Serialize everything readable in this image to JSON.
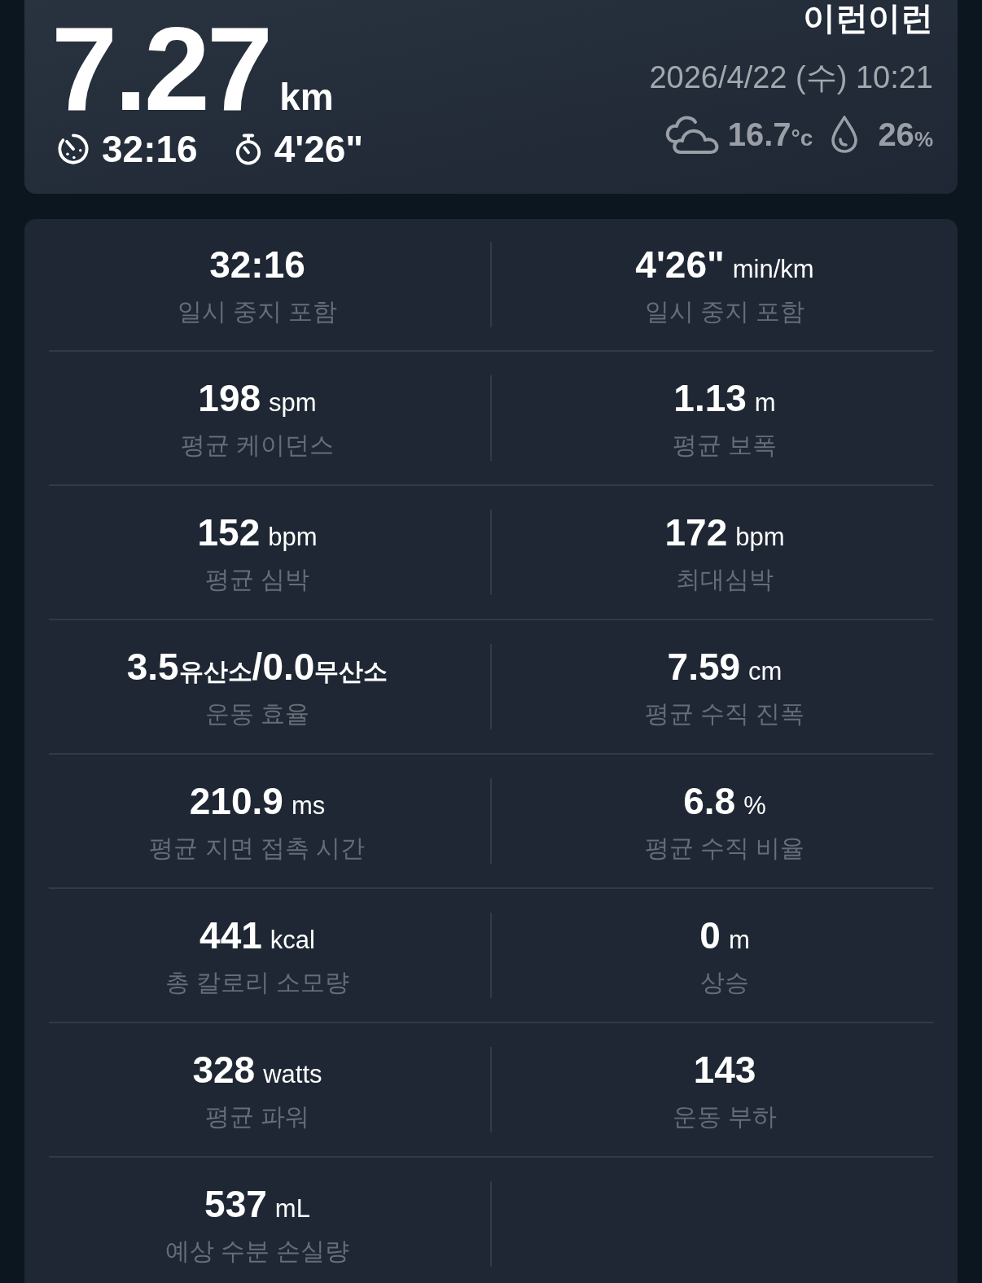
{
  "summary": {
    "distance": {
      "value": "7.27",
      "unit": "km"
    },
    "duration": "32:16",
    "pace": "4'26\"",
    "title": "이런이런",
    "datetime": "2026/4/22 (수) 10:21",
    "weather": {
      "temperature": "16.7",
      "temperature_unit": "°c",
      "humidity": "26",
      "humidity_unit": "%"
    }
  },
  "metrics": [
    {
      "parts": [
        {
          "kind": "number",
          "text": "32:16"
        }
      ],
      "label": "일시 중지 포함"
    },
    {
      "parts": [
        {
          "kind": "number",
          "text": "4'26\""
        },
        {
          "kind": "unit",
          "text": "min/km"
        }
      ],
      "label": "일시 중지 포함"
    },
    {
      "parts": [
        {
          "kind": "number",
          "text": "198"
        },
        {
          "kind": "unit",
          "text": "spm"
        }
      ],
      "label": "평균 케이던스"
    },
    {
      "parts": [
        {
          "kind": "number",
          "text": "1.13"
        },
        {
          "kind": "unit",
          "text": "m"
        }
      ],
      "label": "평균 보폭"
    },
    {
      "parts": [
        {
          "kind": "number",
          "text": "152"
        },
        {
          "kind": "unit",
          "text": "bpm"
        }
      ],
      "label": "평균 심박"
    },
    {
      "parts": [
        {
          "kind": "number",
          "text": "172"
        },
        {
          "kind": "unit",
          "text": "bpm"
        }
      ],
      "label": "최대심박"
    },
    {
      "parts": [
        {
          "kind": "number",
          "text": "3.5"
        },
        {
          "kind": "suffix",
          "text": "유산소"
        },
        {
          "kind": "number",
          "text": "/0.0"
        },
        {
          "kind": "suffix",
          "text": "무산소"
        }
      ],
      "label": "운동 효율"
    },
    {
      "parts": [
        {
          "kind": "number",
          "text": "7.59"
        },
        {
          "kind": "unit",
          "text": "cm"
        }
      ],
      "label": "평균 수직 진폭"
    },
    {
      "parts": [
        {
          "kind": "number",
          "text": "210.9"
        },
        {
          "kind": "unit",
          "text": "ms"
        }
      ],
      "label": "평균 지면 접촉 시간"
    },
    {
      "parts": [
        {
          "kind": "number",
          "text": "6.8"
        },
        {
          "kind": "unit",
          "text": "%"
        }
      ],
      "label": "평균 수직 비율"
    },
    {
      "parts": [
        {
          "kind": "number",
          "text": "441"
        },
        {
          "kind": "unit",
          "text": "kcal"
        }
      ],
      "label": "총 칼로리 소모량"
    },
    {
      "parts": [
        {
          "kind": "number",
          "text": "0"
        },
        {
          "kind": "unit",
          "text": "m"
        }
      ],
      "label": "상승"
    },
    {
      "parts": [
        {
          "kind": "number",
          "text": "328"
        },
        {
          "kind": "unit",
          "text": "watts"
        }
      ],
      "label": "평균 파워"
    },
    {
      "parts": [
        {
          "kind": "number",
          "text": "143"
        }
      ],
      "label": "운동 부하"
    },
    {
      "parts": [
        {
          "kind": "number",
          "text": "537"
        },
        {
          "kind": "unit",
          "text": "mL"
        }
      ],
      "label": "예상 수분 손실량"
    }
  ]
}
